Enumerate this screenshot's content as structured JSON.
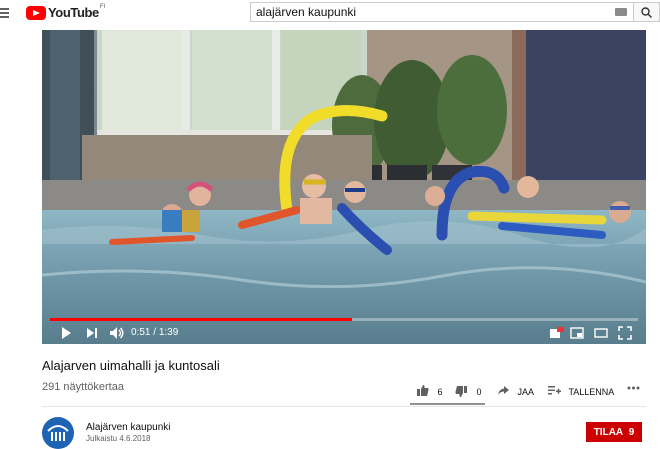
{
  "header": {
    "logo_text": "YouTube",
    "region": "FI",
    "search_value": "alajärven kaupunki"
  },
  "player": {
    "time_current": "0:51",
    "time_duration": "1:39",
    "progress_fraction": 0.514,
    "volume_on": true
  },
  "video": {
    "title": "Alajarven uimahalli ja kuntosali",
    "views": "291 näyttökertaa",
    "likes": "6",
    "dislikes": "0",
    "share_label": "JAA",
    "save_label": "TALLENNA"
  },
  "channel": {
    "name": "Alajärven kaupunki",
    "published": "Julkaistu 4.6.2018",
    "subscribe_label": "TILAA",
    "subscriber_count": "9"
  },
  "colors": {
    "brand_red": "#ff0000",
    "subscribe_red": "#cc0000"
  },
  "icons": [
    "menu-icon",
    "youtube-logo-icon",
    "keyboard-icon",
    "search-icon",
    "play-icon",
    "next-icon",
    "volume-icon",
    "autoplay-icon",
    "miniplayer-icon",
    "theater-icon",
    "fullscreen-icon",
    "like-icon",
    "dislike-icon",
    "share-icon",
    "save-to-playlist-icon",
    "more-icon"
  ]
}
